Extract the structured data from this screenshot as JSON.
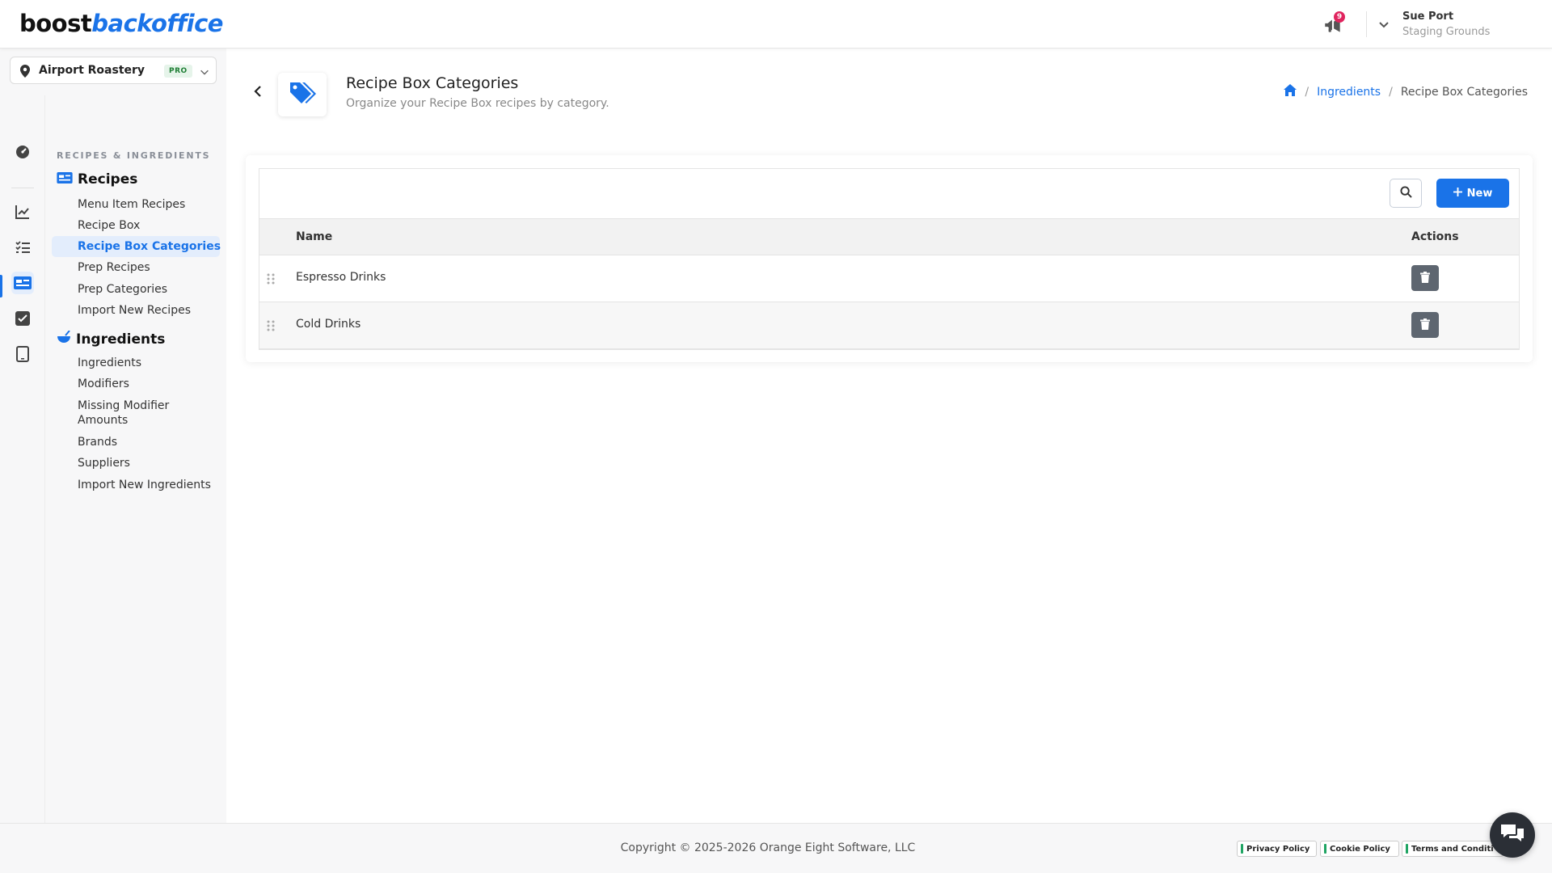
{
  "app": {
    "logo_part1": "boost",
    "logo_part2": "backoffice",
    "notification_count": "9",
    "user_name": "Sue Port",
    "user_org": "Staging Grounds"
  },
  "location": {
    "name": "Airport Roastery",
    "badge": "PRO"
  },
  "rail": {
    "icons": [
      "dashboard-icon",
      "chart-line-icon",
      "checklist-icon",
      "recipe-card-icon",
      "checkbox-icon",
      "tablet-icon"
    ],
    "active": "recipe-card-icon"
  },
  "menu": {
    "section": "RECIPES & INGREDIENTS",
    "recipes": {
      "title": "Recipes",
      "items": [
        "Menu Item Recipes",
        "Recipe Box",
        "Recipe Box Categories",
        "Prep Recipes",
        "Prep Categories",
        "Import New Recipes"
      ]
    },
    "ingredients": {
      "title": "Ingredients",
      "items": [
        "Ingredients",
        "Modifiers",
        "Missing Modifier Amounts",
        "Brands",
        "Suppliers",
        "Import New Ingredients"
      ]
    },
    "active_item": "Recipe Box Categories"
  },
  "page": {
    "title": "Recipe Box Categories",
    "subtitle": "Organize your Recipe Box recipes by category.",
    "breadcrumb": {
      "link": "Ingredients",
      "sep": "/",
      "current": "Recipe Box Categories"
    }
  },
  "table": {
    "new_label": "New",
    "columns": {
      "name": "Name",
      "actions": "Actions"
    },
    "rows": [
      {
        "name": "Espresso Drinks"
      },
      {
        "name": "Cold Drinks"
      }
    ]
  },
  "footer": {
    "copyright": "Copyright © 2025-2026 Orange Eight Software, LLC",
    "links": [
      "Privacy Policy",
      "Cookie Policy",
      "Terms and Conditi"
    ]
  },
  "colors": {
    "accent": "#1a73e8",
    "badge_red": "#e0245e",
    "delete_button": "#5e6670"
  }
}
